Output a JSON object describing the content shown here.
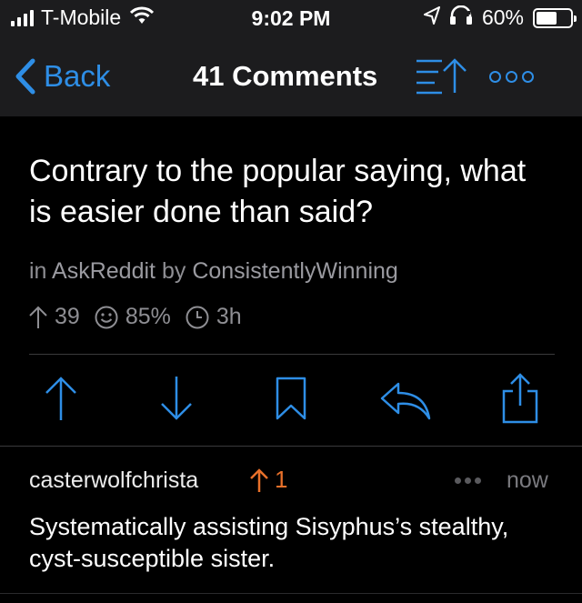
{
  "status_bar": {
    "carrier": "T-Mobile",
    "time": "9:02 PM",
    "battery_percent": "60%",
    "battery_level": 0.6,
    "icons": [
      "signal-icon",
      "wifi-icon",
      "location-icon",
      "headphones-icon",
      "battery-icon"
    ]
  },
  "nav": {
    "back_label": "Back",
    "title": "41 Comments",
    "icons": [
      "chevron-left-icon",
      "sort-icon",
      "more-icon"
    ]
  },
  "post": {
    "title": "Contrary to the popular saying, what is easier done than said?",
    "in_prefix": "in",
    "subreddit": "AskReddit",
    "by_prefix": "by",
    "author": "ConsistentlyWinning",
    "score": "39",
    "upvote_ratio": "85%",
    "age": "3h"
  },
  "actions": {
    "icons": [
      "upvote-icon",
      "downvote-icon",
      "bookmark-icon",
      "reply-icon",
      "share-icon"
    ]
  },
  "comment": {
    "author": "casterwolfchrista",
    "score": "1",
    "time": "now",
    "body": "Systematically assisting Sisyphus’s stealthy, cyst-susceptible sister."
  },
  "colors": {
    "accent": "#2e8ee6",
    "upvote_orange": "#e8702a",
    "background": "#000000",
    "bar_background": "#1c1c1e",
    "secondary_text": "#8e8e93"
  }
}
